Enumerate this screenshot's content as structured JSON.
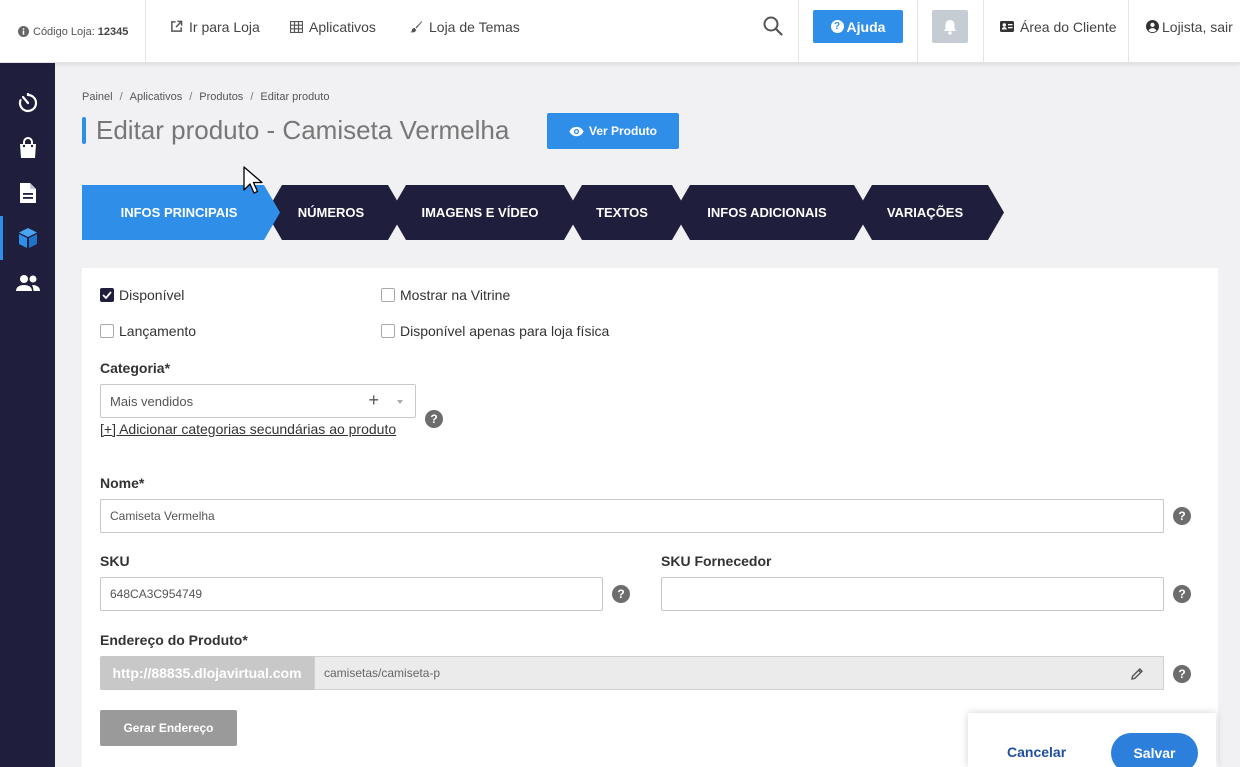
{
  "colors": {
    "accent": "#2f8fe8",
    "sidebar": "#1f1e3d",
    "step_active": "#2f8fe8",
    "step_inactive": "#1f1e3d"
  },
  "topbar": {
    "store_label": "Código Loja:",
    "store_code": "12345",
    "links": [
      "Ir para Loja",
      "Aplicativos",
      "Loja de Temas"
    ],
    "help_label": "Ajuda",
    "client_area": "Área do Cliente",
    "user": "Lojista, sair"
  },
  "sidebar": {
    "items": [
      "dashboard-icon",
      "shopping-bag-icon",
      "document-icon",
      "cube-icon",
      "users-icon"
    ],
    "active": "cube-icon"
  },
  "breadcrumb": [
    "Painel",
    "Aplicativos",
    "Produtos",
    "Editar produto"
  ],
  "page_title": "Editar produto - Camiseta Vermelha",
  "view_button": "Ver Produto",
  "steps": [
    "INFOS PRINCIPAIS",
    "NÚMEROS",
    "IMAGENS E VÍDEO",
    "TEXTOS",
    "INFOS ADICIONAIS",
    "VARIAÇÕES"
  ],
  "active_step": "INFOS PRINCIPAIS",
  "form": {
    "checkboxes": [
      {
        "label": "Disponível",
        "checked": true
      },
      {
        "label": "Mostrar na Vitrine",
        "checked": false
      },
      {
        "label": "Lançamento",
        "checked": false
      },
      {
        "label": "Disponível apenas para loja física",
        "checked": false
      }
    ],
    "category_label": "Categoria*",
    "category_value": "Mais vendidos",
    "add_category_link": "[+] Adicionar categorias secundárias ao produto",
    "name_label": "Nome*",
    "name_value": "Camiseta Vermelha",
    "sku_label": "SKU",
    "sku_value": "648CA3C954749",
    "sku_supplier_label": "SKU Fornecedor",
    "sku_supplier_value": "",
    "url_label": "Endereço do Produto*",
    "url_prefix": "http://88835.dlojavirtual.com",
    "url_value": "camisetas/camiseta-p",
    "generate_button": "Gerar Endereço"
  },
  "footer": {
    "cancel": "Cancelar",
    "save": "Salvar"
  }
}
